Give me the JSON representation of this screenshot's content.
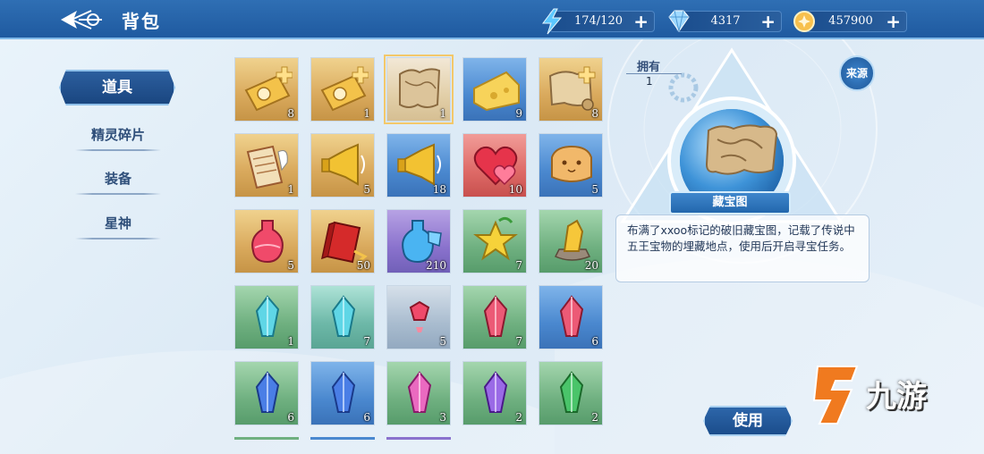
{
  "header": {
    "title": "背包",
    "resources": [
      {
        "name": "stamina",
        "icon": "lightning-icon",
        "value": "174/120",
        "plus": "+"
      },
      {
        "name": "diamond",
        "icon": "diamond-icon",
        "value": "4317",
        "plus": "+"
      },
      {
        "name": "gold",
        "icon": "coin-icon",
        "value": "457900",
        "plus": "+"
      }
    ]
  },
  "sidebar": {
    "tabs": [
      {
        "label": "道具",
        "active": true
      },
      {
        "label": "精灵碎片",
        "active": false
      },
      {
        "label": "装备",
        "active": false
      },
      {
        "label": "星神",
        "active": false
      }
    ]
  },
  "inventory": {
    "items": [
      {
        "icon": "ticket-icon",
        "quality": "gold",
        "count": "8"
      },
      {
        "icon": "ticket-icon",
        "quality": "gold",
        "count": "1"
      },
      {
        "icon": "treasure-map-icon",
        "quality": "pale",
        "count": "1",
        "selected": true
      },
      {
        "icon": "cheese-icon",
        "quality": "blue",
        "count": "9"
      },
      {
        "icon": "map-scroll-icon",
        "quality": "gold",
        "count": "8"
      },
      {
        "icon": "scroll-quill-icon",
        "quality": "gold",
        "count": "1"
      },
      {
        "icon": "megaphone-icon",
        "quality": "gold",
        "count": "5"
      },
      {
        "icon": "megaphone-icon",
        "quality": "blue",
        "count": "18"
      },
      {
        "icon": "heart-icon",
        "quality": "red",
        "count": "10"
      },
      {
        "icon": "bread-icon",
        "quality": "blue",
        "count": "5"
      },
      {
        "icon": "potion-icon",
        "quality": "gold",
        "count": "5"
      },
      {
        "icon": "red-book-icon",
        "quality": "gold",
        "count": "50"
      },
      {
        "icon": "blue-potion-icon",
        "quality": "purple",
        "count": "210"
      },
      {
        "icon": "star-fruit-icon",
        "quality": "green",
        "count": "7"
      },
      {
        "icon": "crystal-rock-icon",
        "quality": "green",
        "count": "20"
      },
      {
        "icon": "cyan-crystal-icon",
        "quality": "green",
        "count": "1"
      },
      {
        "icon": "cyan-crystal-icon",
        "quality": "teal",
        "count": "7"
      },
      {
        "icon": "red-gem-icon",
        "quality": "gray",
        "count": "5"
      },
      {
        "icon": "red-crystal-icon",
        "quality": "green",
        "count": "7"
      },
      {
        "icon": "red-crystal-icon",
        "quality": "blue",
        "count": "6"
      },
      {
        "icon": "blue-crystal-icon",
        "quality": "green",
        "count": "6"
      },
      {
        "icon": "blue-crystal-icon",
        "quality": "blue",
        "count": "6"
      },
      {
        "icon": "pink-crystal-icon",
        "quality": "green",
        "count": "3"
      },
      {
        "icon": "purple-crystal-icon",
        "quality": "green",
        "count": "2"
      },
      {
        "icon": "green-crystal-icon",
        "quality": "green",
        "count": "2"
      }
    ]
  },
  "detail": {
    "own_label": "拥有",
    "own_value": "1",
    "source_label": "来源",
    "name": "藏宝图",
    "description": "布满了xxoo标记的破旧藏宝图，记载了传说中五王宝物的埋藏地点，使用后开启寻宝任务。"
  },
  "actions": {
    "use_label": "使用"
  },
  "watermark": {
    "text": "九游"
  },
  "colors": {
    "accent": "#1f5aa0",
    "highlight": "#f3c86a"
  }
}
